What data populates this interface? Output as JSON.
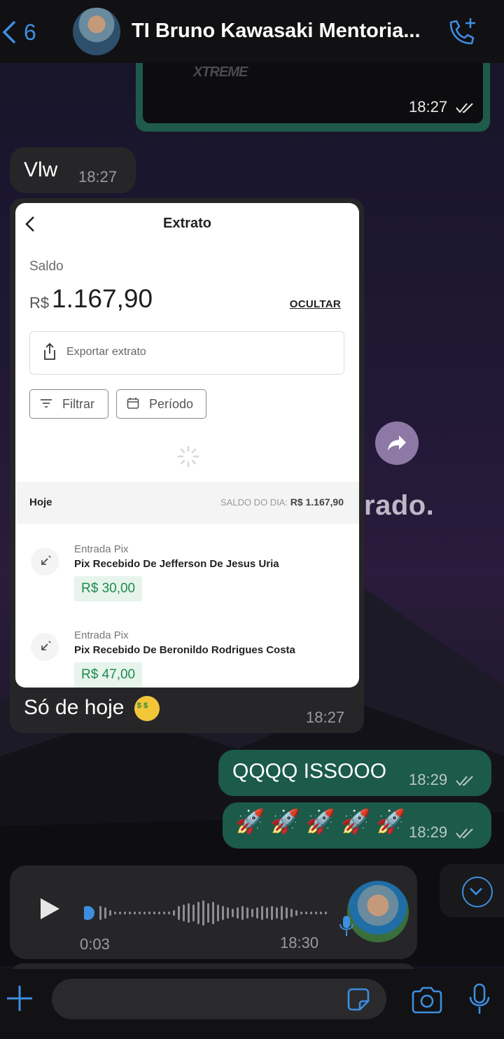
{
  "header": {
    "back_count": "6",
    "title": "TI Bruno Kawasaki Mentoria..."
  },
  "messages": {
    "image_time": "18:27",
    "vlw_text": "Vlw",
    "vlw_time": "18:27",
    "statement_caption": "Só de hoje",
    "statement_time": "18:27",
    "sent1_text": "QQQQ ISSOOO",
    "sent1_time": "18:29",
    "sent2_time": "18:29",
    "rockets": [
      "🚀",
      "🚀",
      "🚀",
      "🚀",
      "🚀"
    ],
    "image_watermark": "XTREME",
    "background_text": "rado."
  },
  "statement": {
    "title": "Extrato",
    "saldo_label": "Saldo",
    "currency": "R$",
    "balance": "1.167,90",
    "hide_label": "OCULTAR",
    "export_label": "Exportar extrato",
    "filter_label": "Filtrar",
    "period_label": "Período",
    "day_label": "Hoje",
    "day_balance_label": "SALDO DO DIA:",
    "day_balance_value": "R$ 1.167,90",
    "transactions": [
      {
        "type": "Entrada Pix",
        "desc": "Pix Recebido De Jefferson De Jesus Uria",
        "amount": "R$ 30,00"
      },
      {
        "type": "Entrada Pix",
        "desc": "Pix Recebido De Beronildo Rodrigues Costa",
        "amount": "R$ 47,00"
      }
    ]
  },
  "audio": {
    "duration": "0:03",
    "time": "18:30"
  },
  "colors": {
    "accent": "#3d8ee0",
    "sent_bubble": "#1c5a4a",
    "received_bubble": "#262628",
    "pix_green": "#1e8a4d"
  }
}
